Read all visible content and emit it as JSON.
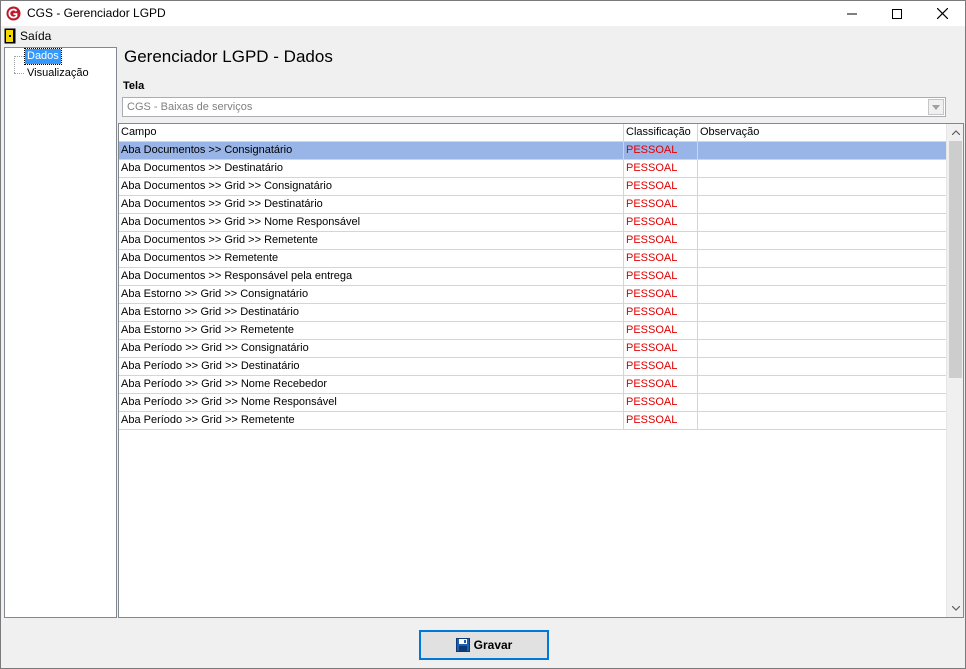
{
  "window": {
    "title": "CGS - Gerenciador LGPD"
  },
  "menu": {
    "exit_label": "Saída"
  },
  "tree": {
    "items": [
      "Dados",
      "Visualização"
    ]
  },
  "content": {
    "title": "Gerenciador LGPD - Dados",
    "tela_label": "Tela",
    "tela_value": "CGS - Baixas de serviços"
  },
  "grid": {
    "columns": [
      "Campo",
      "Classificação",
      "Observação"
    ],
    "rows": [
      [
        "Aba Documentos >> Consignatário",
        "PESSOAL",
        ""
      ],
      [
        "Aba Documentos >> Destinatário",
        "PESSOAL",
        ""
      ],
      [
        "Aba Documentos >> Grid >> Consignatário",
        "PESSOAL",
        ""
      ],
      [
        "Aba Documentos >> Grid >> Destinatário",
        "PESSOAL",
        ""
      ],
      [
        "Aba Documentos >> Grid >> Nome Responsável",
        "PESSOAL",
        ""
      ],
      [
        "Aba Documentos >> Grid >> Remetente",
        "PESSOAL",
        ""
      ],
      [
        "Aba Documentos >> Remetente",
        "PESSOAL",
        ""
      ],
      [
        "Aba Documentos >> Responsável pela entrega",
        "PESSOAL",
        ""
      ],
      [
        "Aba Estorno >> Grid >> Consignatário",
        "PESSOAL",
        ""
      ],
      [
        "Aba Estorno >> Grid >> Destinatário",
        "PESSOAL",
        ""
      ],
      [
        "Aba Estorno >> Grid >> Remetente",
        "PESSOAL",
        ""
      ],
      [
        "Aba Período >> Grid >> Consignatário",
        "PESSOAL",
        ""
      ],
      [
        "Aba Período >> Grid >> Destinatário",
        "PESSOAL",
        ""
      ],
      [
        "Aba Período >> Grid >> Nome Recebedor",
        "PESSOAL",
        ""
      ],
      [
        "Aba Período >> Grid >> Nome Responsável",
        "PESSOAL",
        ""
      ],
      [
        "Aba Período >> Grid >> Remetente",
        "PESSOAL",
        ""
      ]
    ]
  },
  "buttons": {
    "save_label": "Gravar"
  },
  "colors": {
    "classification": "#e00000",
    "selected_row": "#99b4e6",
    "tree_selected": "#3399ff"
  },
  "icons": [
    "app-icon",
    "exit-icon",
    "minimize-icon",
    "maximize-icon",
    "close-icon",
    "chevron-down-icon",
    "floppy-disk-icon"
  ]
}
